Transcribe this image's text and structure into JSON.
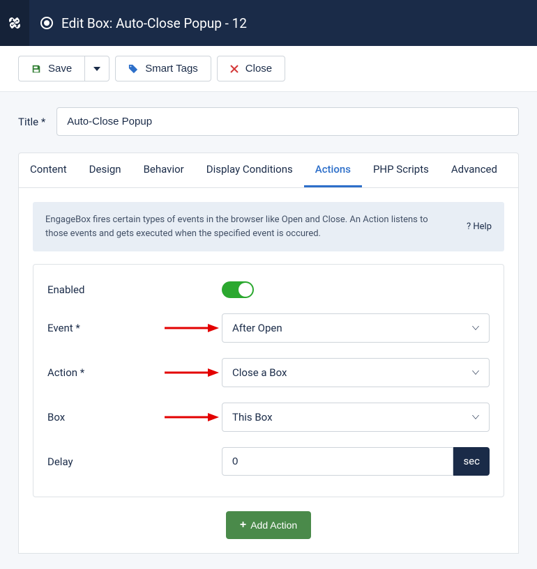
{
  "topbar": {
    "title": "Edit Box: Auto-Close Popup - 12"
  },
  "toolbar": {
    "save_label": "Save",
    "smart_tags_label": "Smart Tags",
    "close_label": "Close"
  },
  "title_field": {
    "label": "Title *",
    "value": "Auto-Close Popup"
  },
  "tabs": [
    {
      "label": "Content",
      "active": false
    },
    {
      "label": "Design",
      "active": false
    },
    {
      "label": "Behavior",
      "active": false
    },
    {
      "label": "Display Conditions",
      "active": false
    },
    {
      "label": "Actions",
      "active": true
    },
    {
      "label": "PHP Scripts",
      "active": false
    },
    {
      "label": "Advanced",
      "active": false
    }
  ],
  "info": {
    "text": "EngageBox fires certain types of events in the browser like Open and Close. An Action listens to those events and gets executed when the specified event is occured.",
    "help_label": "? Help"
  },
  "form": {
    "enabled": {
      "label": "Enabled",
      "value": true
    },
    "event": {
      "label": "Event *",
      "value": "After Open"
    },
    "action": {
      "label": "Action *",
      "value": "Close a Box"
    },
    "box": {
      "label": "Box",
      "value": "This Box"
    },
    "delay": {
      "label": "Delay",
      "value": "0",
      "suffix": "sec"
    }
  },
  "add_action_label": "Add Action"
}
